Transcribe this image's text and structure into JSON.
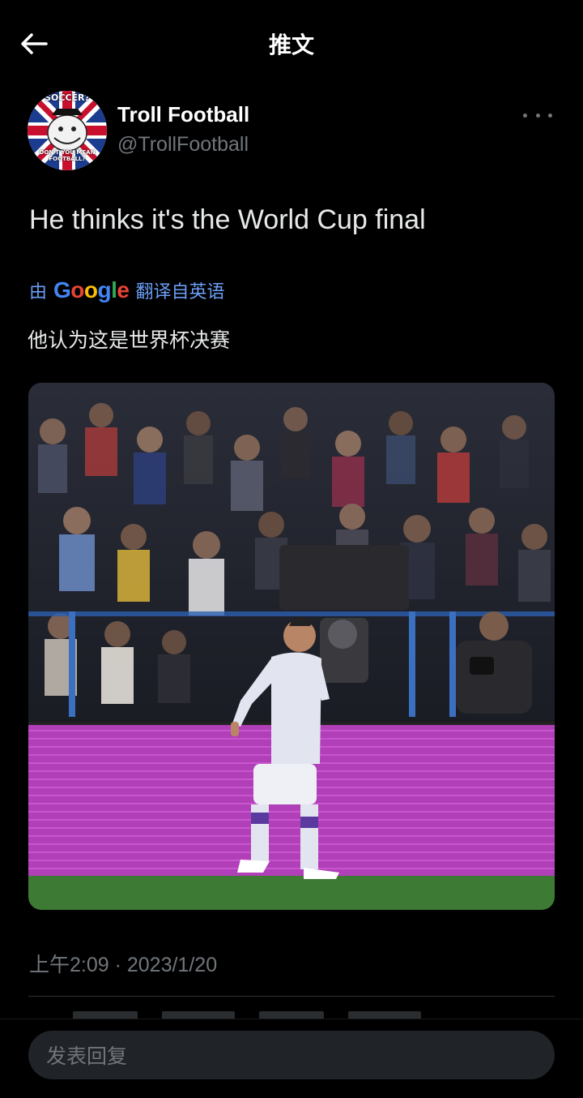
{
  "header": {
    "title": "推文"
  },
  "author": {
    "display_name": "Troll Football",
    "handle": "@TrollFootball",
    "avatar_top_text": "SOCCER?",
    "avatar_bottom_text": "DON'T YOU MEAN FOOTBALL?"
  },
  "tweet": {
    "text": "He thinks it's the World Cup final",
    "translate_prefix": "由",
    "translate_brand": "Google",
    "translate_suffix": "翻译自英语",
    "translation": "他认为这是世界杯决赛",
    "timestamp": "上午2:09 · 2023/1/20"
  },
  "reply": {
    "placeholder": "发表回复"
  },
  "colors": {
    "background": "#000000",
    "text": "#e7e9ea",
    "muted": "#71767b",
    "link": "#6b9ef5",
    "board": "#b13fb8"
  }
}
